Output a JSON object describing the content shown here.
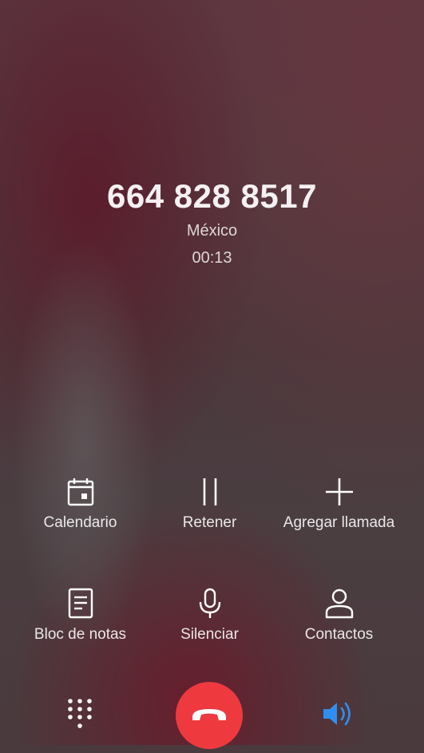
{
  "call": {
    "number": "664 828 8517",
    "location": "México",
    "duration": "00:13"
  },
  "actions": {
    "calendar": "Calendario",
    "hold": "Retener",
    "add_call": "Agregar llamada",
    "notes": "Bloc de notas",
    "mute": "Silenciar",
    "contacts": "Contactos"
  },
  "bottom_bar": {
    "dialpad_icon": "dialpad-icon",
    "end_call_icon": "phone-hangup-icon",
    "speaker_icon": "speaker-icon",
    "end_call_color": "#ee3a3f",
    "speaker_active_color": "#2f8ff0"
  }
}
